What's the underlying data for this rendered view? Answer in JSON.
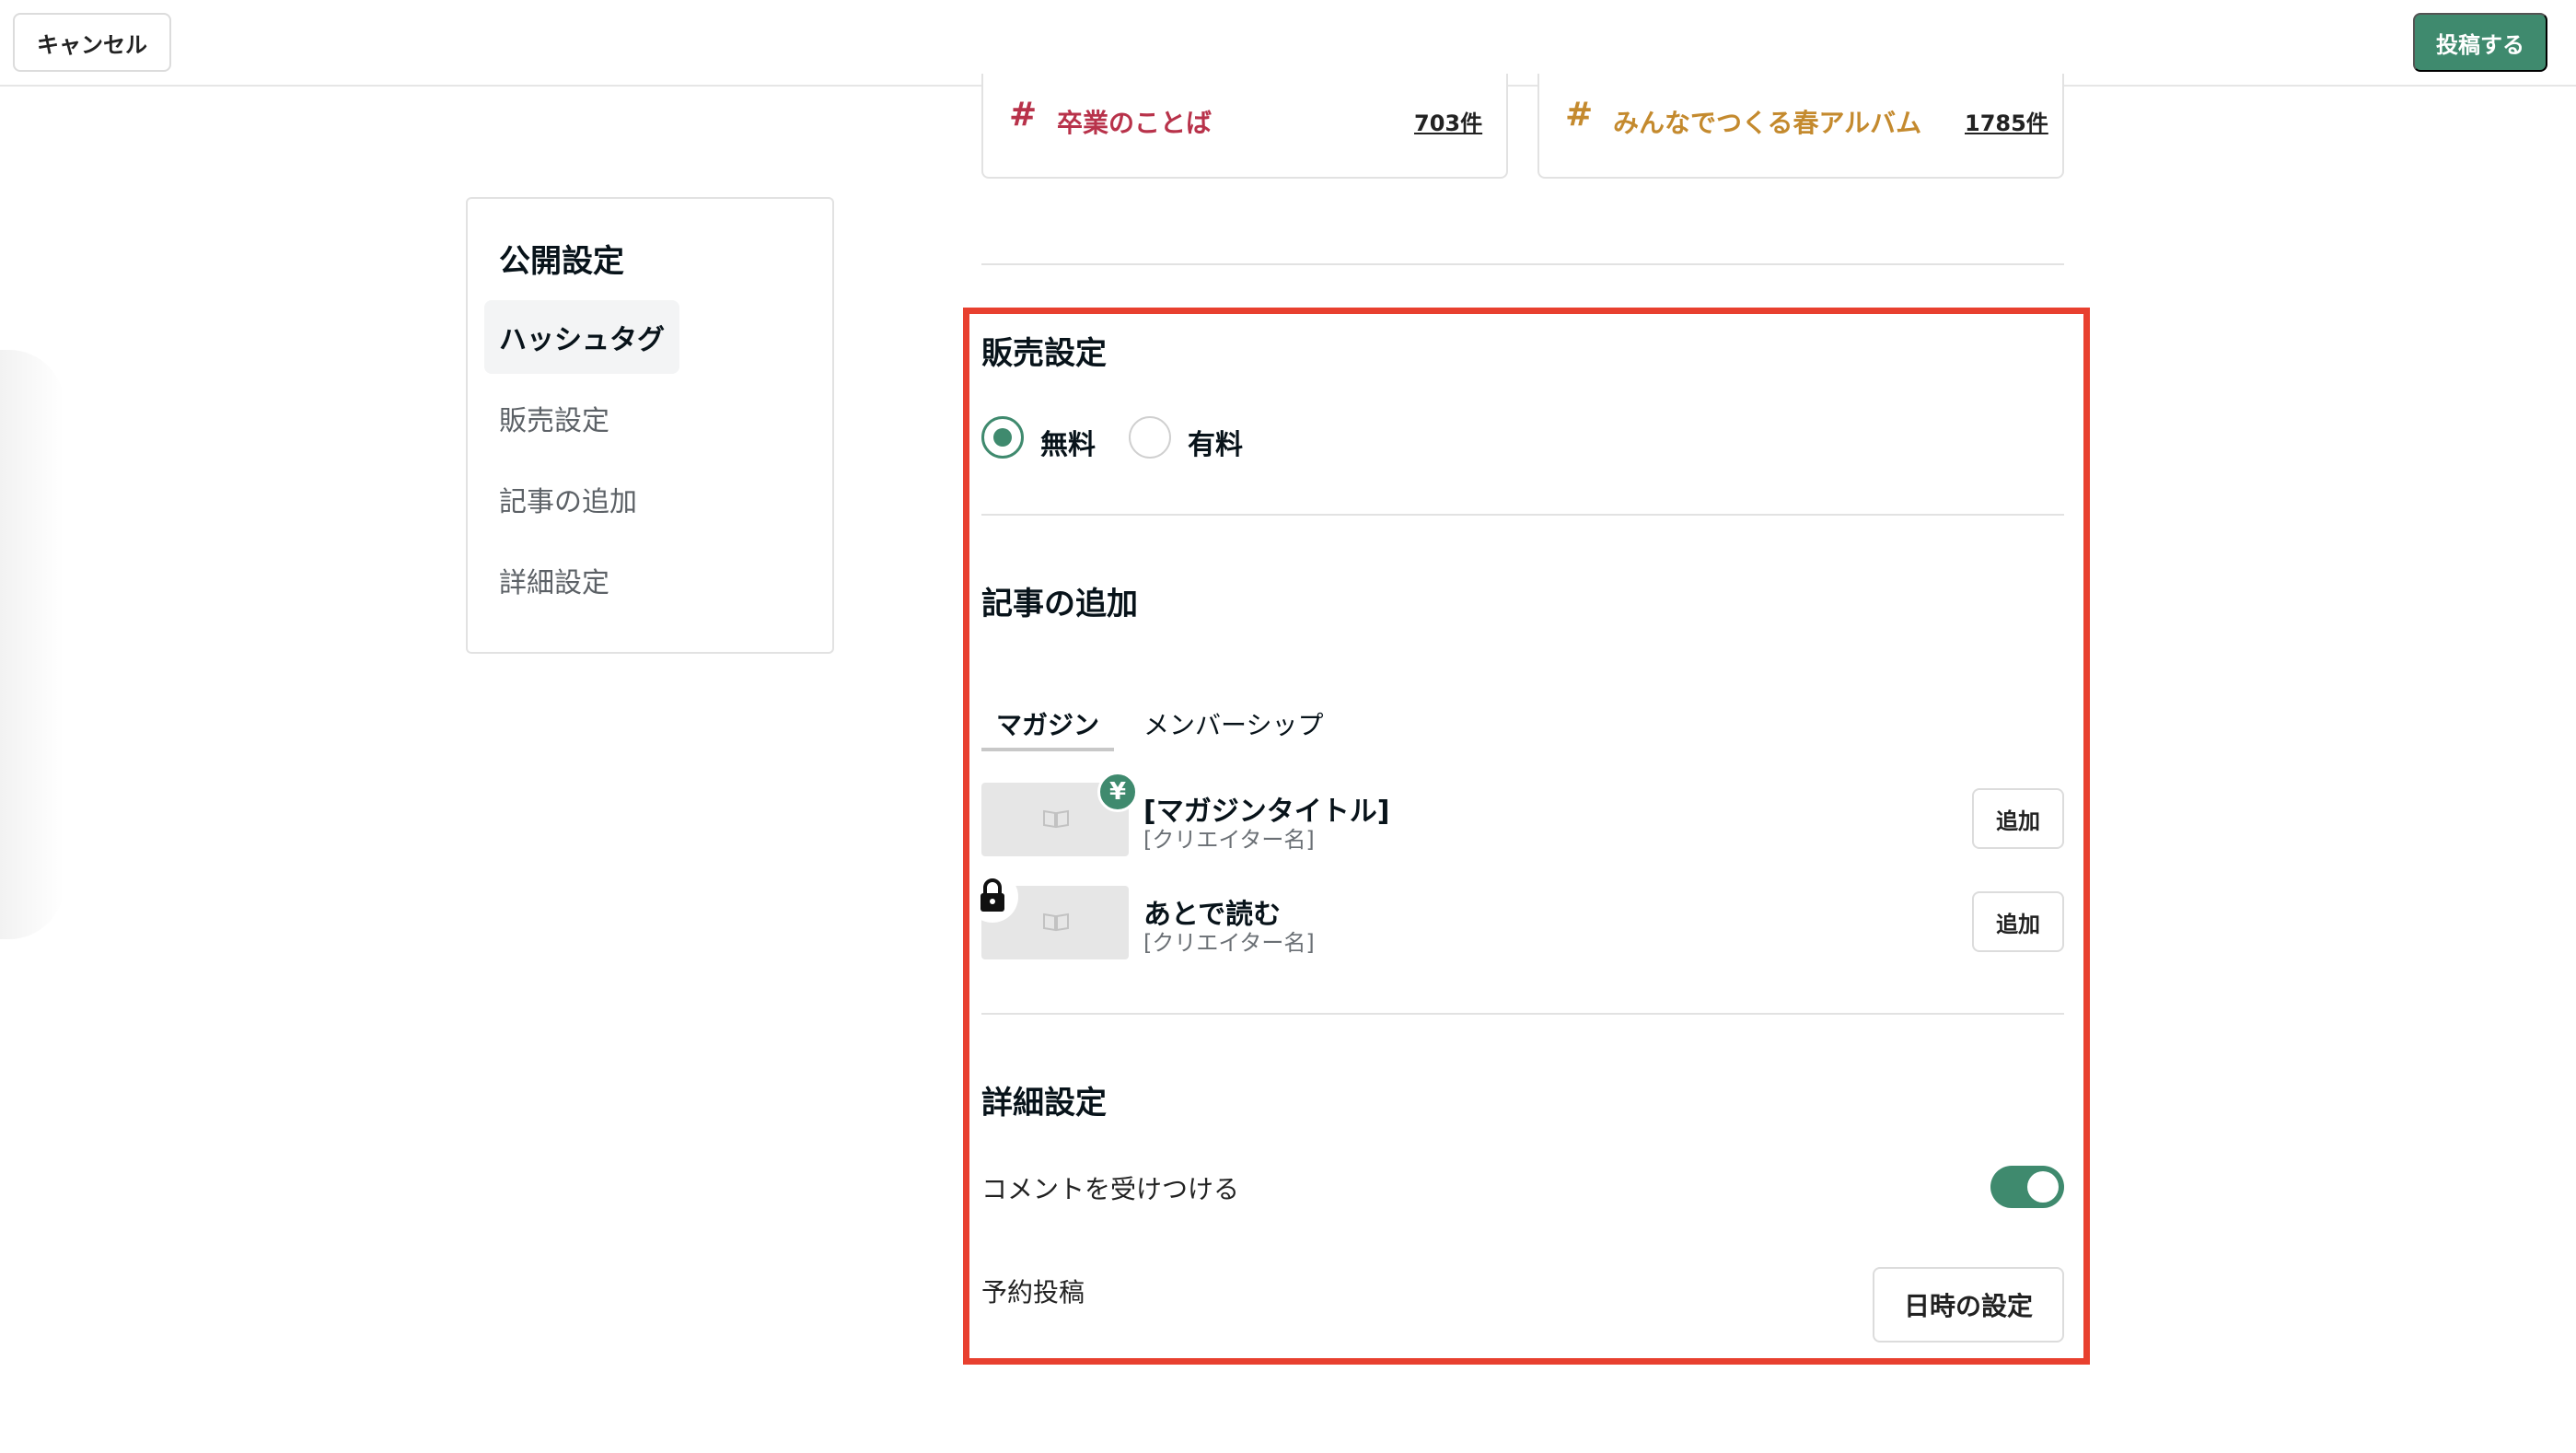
{
  "header": {
    "cancel_label": "キャンセル",
    "post_label": "投稿する"
  },
  "hashtags": [
    {
      "symbol": "#",
      "name": "卒業のことば",
      "count": "703件",
      "color": "#b8324a"
    },
    {
      "symbol": "#",
      "name": "みんなでつくる春アルバム",
      "count": "1785件",
      "color": "#c48a2e"
    }
  ],
  "sidebar": {
    "title": "公開設定",
    "items": [
      {
        "label": "ハッシュタグ",
        "active": true
      },
      {
        "label": "販売設定",
        "active": false
      },
      {
        "label": "記事の追加",
        "active": false
      },
      {
        "label": "詳細設定",
        "active": false
      }
    ]
  },
  "sales": {
    "title": "販売設定",
    "options": [
      {
        "label": "無料",
        "selected": true
      },
      {
        "label": "有料",
        "selected": false
      }
    ]
  },
  "add_article": {
    "title": "記事の追加",
    "tabs": [
      {
        "label": "マガジン",
        "active": true
      },
      {
        "label": "メンバーシップ",
        "active": false
      }
    ],
    "magazines": [
      {
        "title": "[マガジンタイトル]",
        "creator": "[クリエイター名]",
        "badge": "¥",
        "add_label": "追加"
      },
      {
        "title": "あとで読む",
        "creator": "[クリエイター名]",
        "badge": "lock-icon",
        "add_label": "追加"
      }
    ]
  },
  "details": {
    "title": "詳細設定",
    "comment_label": "コメントを受けつける",
    "comment_enabled": true,
    "schedule_label": "予約投稿",
    "schedule_button": "日時の設定"
  },
  "colors": {
    "accent": "#3f8a6e",
    "highlight": "#e8402f"
  }
}
